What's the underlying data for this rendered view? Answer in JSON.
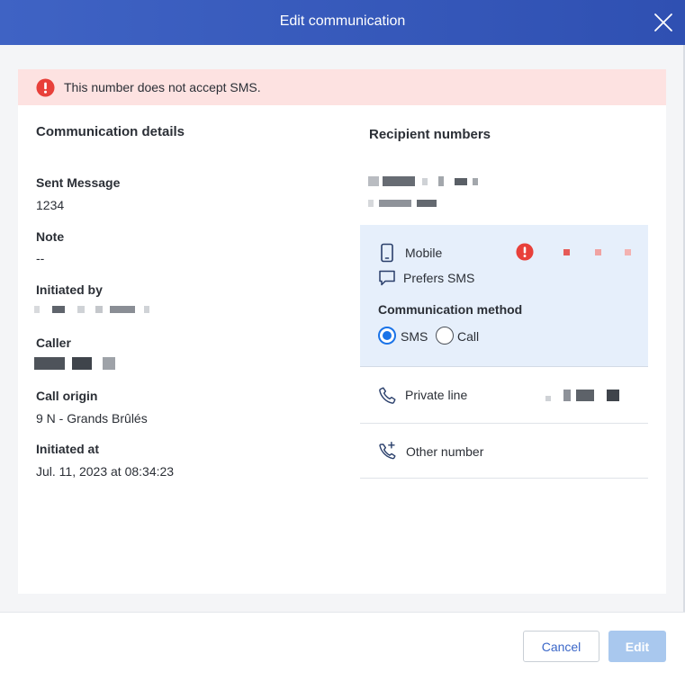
{
  "header": {
    "title": "Edit communication"
  },
  "alert": {
    "message": "This number does not accept SMS.",
    "color": "#e8403a"
  },
  "details": {
    "title": "Communication details",
    "sent_message_label": "Sent Message",
    "sent_message_value": "1234",
    "note_label": "Note",
    "note_value": "--",
    "initiated_by_label": "Initiated by",
    "caller_label": "Caller",
    "call_origin_label": "Call origin",
    "call_origin_value": "9 N - Grands Brûlés",
    "initiated_at_label": "Initiated at",
    "initiated_at_value": "Jul. 11, 2023 at 08:34:23"
  },
  "recipients": {
    "title": "Recipient numbers",
    "mobile": {
      "label": "Mobile",
      "preference": "Prefers SMS",
      "method_label": "Communication method",
      "options": [
        {
          "label": "SMS",
          "selected": true
        },
        {
          "label": "Call",
          "selected": false
        }
      ]
    },
    "private_line": {
      "label": "Private line"
    },
    "other_number": {
      "label": "Other number"
    }
  },
  "footer": {
    "cancel_label": "Cancel",
    "edit_label": "Edit"
  },
  "colors": {
    "header": "#3557bb",
    "primary": "#1a73e8",
    "error": "#e8403a",
    "selected_row": "#e6effb",
    "disabled_button": "#a9c8ee"
  },
  "icons": [
    "close-icon",
    "error-icon",
    "mobile-phone-icon",
    "chat-bubble-icon",
    "phone-icon",
    "phone-add-icon"
  ]
}
